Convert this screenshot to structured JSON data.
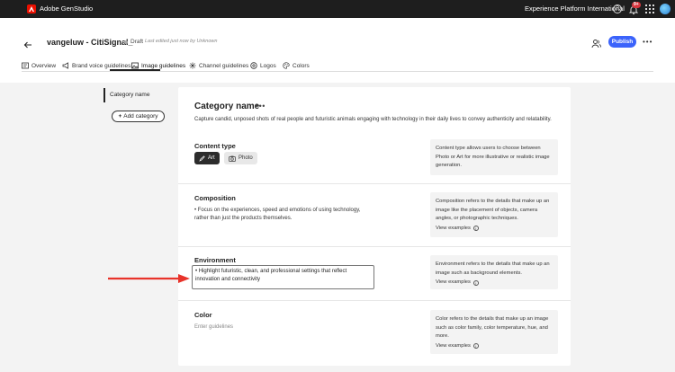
{
  "topbar": {
    "app_title": "Adobe GenStudio",
    "org_name": "Experience Platform International",
    "notification_badge": "9+"
  },
  "header": {
    "doc_title": "vangeluw - CitiSignal_",
    "status": "Draft",
    "last_edited": "Last edited just now by Unknown",
    "publish_label": "Publish",
    "tabs": [
      {
        "label": "Overview",
        "icon": "overview-icon"
      },
      {
        "label": "Brand voice guidelines",
        "icon": "megaphone-icon"
      },
      {
        "label": "Image guidelines",
        "icon": "image-icon",
        "active": true
      },
      {
        "label": "Channel guidelines",
        "icon": "channels-icon"
      },
      {
        "label": "Logos",
        "icon": "logo-icon"
      },
      {
        "label": "Colors",
        "icon": "palette-icon"
      }
    ]
  },
  "sidebar": {
    "items": [
      {
        "label": "Category name"
      }
    ],
    "add_label": "Add category"
  },
  "category": {
    "title": "Category name",
    "description": "Capture candid, unposed shots of real people and futuristic animals engaging with technology in their daily lives to convey authenticity and relatability."
  },
  "sections": {
    "content_type": {
      "title": "Content type",
      "options": [
        "Art",
        "Photo"
      ],
      "selected": "Art",
      "info": "Content type allows users to choose between Photo or Art for more illustrative or realistic image generation."
    },
    "composition": {
      "title": "Composition",
      "text": "• Focus on the experiences, speed and emotions of using technology, rather than just the products themselves.",
      "info": "Composition refers to the details that make up an image like the placement of objects, camera angles, or photographic techniques.",
      "view_examples": "View examples"
    },
    "environment": {
      "title": "Environment",
      "text": "• Highlight futuristic, clean, and professional settings that reflect innovation and connectivity",
      "info": "Environment refers to the details that make up an image such as background elements.",
      "view_examples": "View examples"
    },
    "color": {
      "title": "Color",
      "placeholder": "Enter guidelines",
      "info": "Color refers to the details that make up an image such as color family, color temperature, hue, and more.",
      "view_examples": "View examples"
    }
  },
  "colors": {
    "accent": "#3b63fb",
    "annotation_arrow": "#e8332a",
    "topbar": "#1e1e1e"
  }
}
